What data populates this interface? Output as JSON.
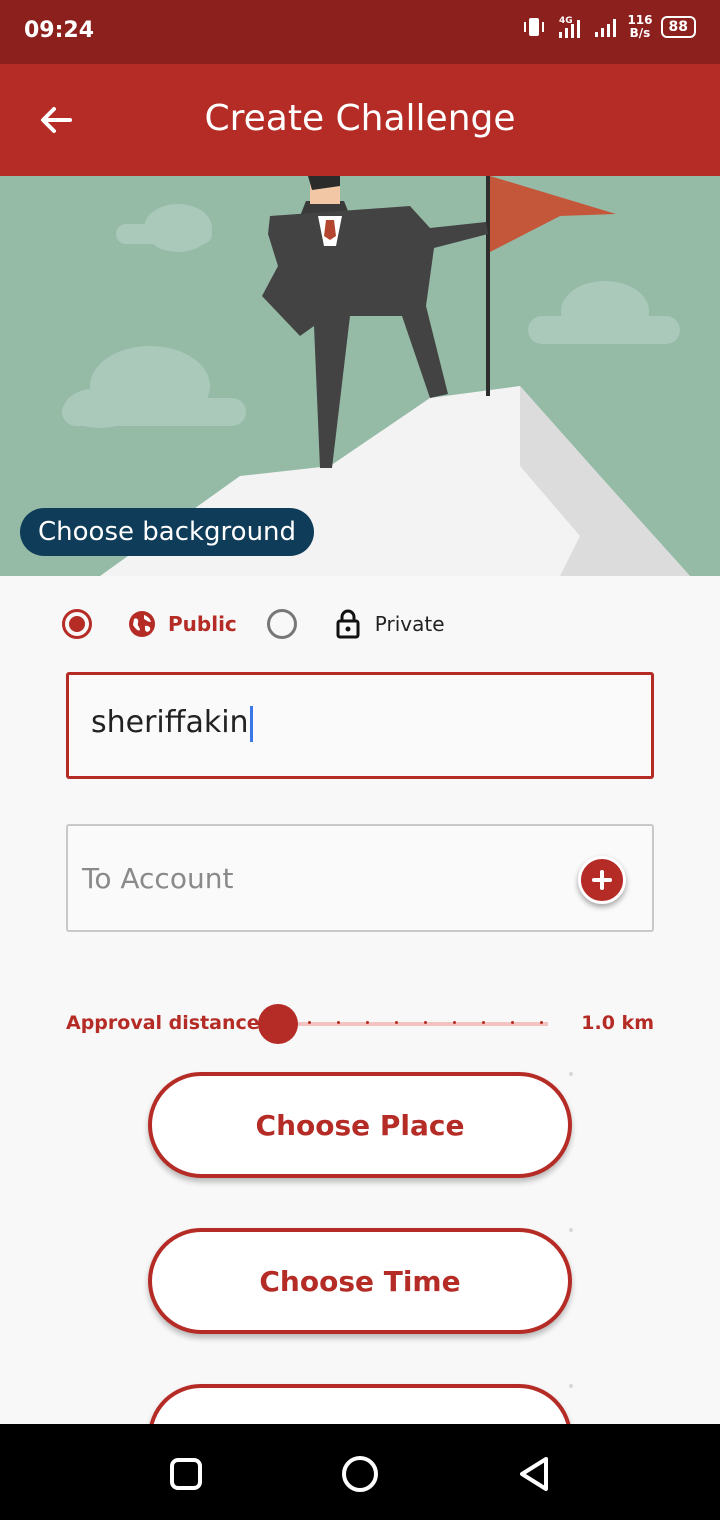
{
  "status_bar": {
    "time": "09:24",
    "network": "4G",
    "speed_value": "116",
    "speed_unit": "B/s",
    "battery": "88"
  },
  "app_bar": {
    "title": "Create Challenge",
    "back_icon": "arrow-left-icon"
  },
  "hero": {
    "choose_background_label": "Choose background"
  },
  "privacy": {
    "options": [
      {
        "label": "Public",
        "icon": "globe-icon",
        "selected": true
      },
      {
        "label": "Private",
        "icon": "lock-icon",
        "selected": false
      }
    ]
  },
  "form": {
    "title_value": "sheriffakin",
    "to_account_placeholder": "To Account"
  },
  "distance": {
    "label": "Approval distance",
    "value_label": "1.0 km",
    "slider_fraction": 0
  },
  "buttons": {
    "choose_place": "Choose Place",
    "choose_time": "Choose Time"
  },
  "colors": {
    "primary": "#b52b25",
    "status_bar": "#8c201d",
    "chip": "#0f3c59",
    "hero_bg": "#95bba7"
  }
}
